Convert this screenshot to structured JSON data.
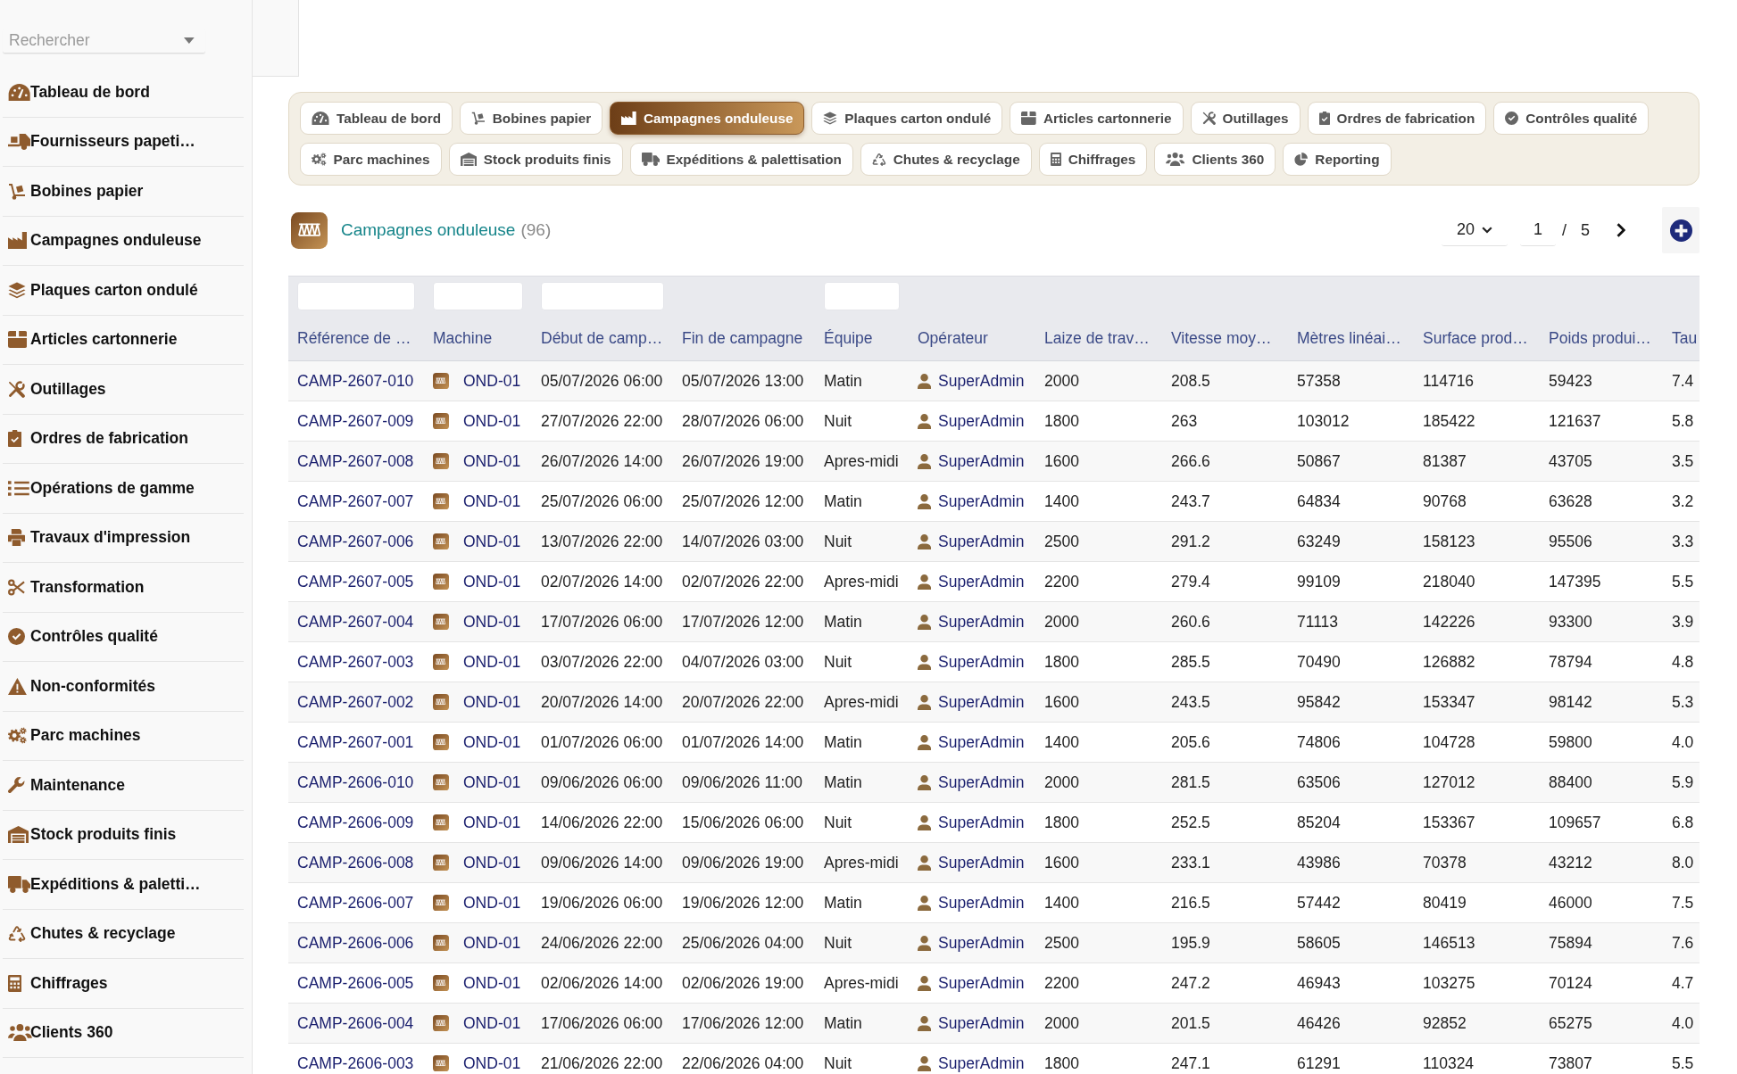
{
  "sidebar": {
    "search": {
      "placeholder": "Rechercher"
    },
    "items": [
      "Tableau de bord",
      "Fournisseurs papeti…",
      "Bobines papier",
      "Campagnes onduleuse",
      "Plaques carton ondulé",
      "Articles cartonnerie",
      "Outillages",
      "Ordres de fabrication",
      "Opérations de gamme",
      "Travaux d'impression",
      "Transformation",
      "Contrôles qualité",
      "Non-conformités",
      "Parc machines",
      "Maintenance",
      "Stock produits finis",
      "Expéditions & paletti…",
      "Chutes & recyclage",
      "Chiffrages",
      "Clients 360"
    ]
  },
  "tabs": [
    {
      "label": "Tableau de bord",
      "selected": false
    },
    {
      "label": "Bobines papier",
      "selected": false
    },
    {
      "label": "Campagnes onduleuse",
      "selected": true
    },
    {
      "label": "Plaques carton ondulé",
      "selected": false
    },
    {
      "label": "Articles cartonnerie",
      "selected": false
    },
    {
      "label": "Outillages",
      "selected": false
    },
    {
      "label": "Ordres de fabrication",
      "selected": false
    },
    {
      "label": "Contrôles qualité",
      "selected": false
    },
    {
      "label": "Parc machines",
      "selected": false
    },
    {
      "label": "Stock produits finis",
      "selected": false
    },
    {
      "label": "Expéditions & palettisation",
      "selected": false
    },
    {
      "label": "Chutes & recyclage",
      "selected": false
    },
    {
      "label": "Chiffrages",
      "selected": false
    },
    {
      "label": "Clients 360",
      "selected": false
    },
    {
      "label": "Reporting",
      "selected": false
    }
  ],
  "header": {
    "title": "Campagnes onduleuse",
    "count": "(96)"
  },
  "pagination": {
    "page_size": "20",
    "page": "1",
    "separator": "/",
    "total_pages": "5"
  },
  "table": {
    "columns": [
      {
        "label": "Référence de …",
        "kind": "link",
        "filter": true
      },
      {
        "label": "Machine",
        "kind": "machine",
        "filter": true
      },
      {
        "label": "Début de camp…",
        "kind": "text",
        "filter": true
      },
      {
        "label": "Fin de campagne",
        "kind": "text",
        "filter": false
      },
      {
        "label": "Équipe",
        "kind": "text",
        "filter": true
      },
      {
        "label": "Opérateur",
        "kind": "operator",
        "filter": false
      },
      {
        "label": "Laize de trav…",
        "kind": "text",
        "filter": false
      },
      {
        "label": "Vitesse moy…",
        "kind": "text",
        "filter": false
      },
      {
        "label": "Mètres linéai…",
        "kind": "text",
        "filter": false
      },
      {
        "label": "Surface prod…",
        "kind": "text",
        "filter": false
      },
      {
        "label": "Poids produi…",
        "kind": "text",
        "filter": false
      },
      {
        "label": "Tau",
        "kind": "text",
        "filter": false
      }
    ],
    "rows": [
      [
        "CAMP-2607-010",
        "OND-01",
        "05/07/2026 06:00",
        "05/07/2026 13:00",
        "Matin",
        "SuperAdmin",
        "2000",
        "208.5",
        "57358",
        "114716",
        "59423",
        "7.4"
      ],
      [
        "CAMP-2607-009",
        "OND-01",
        "27/07/2026 22:00",
        "28/07/2026 06:00",
        "Nuit",
        "SuperAdmin",
        "1800",
        "263",
        "103012",
        "185422",
        "121637",
        "5.8"
      ],
      [
        "CAMP-2607-008",
        "OND-01",
        "26/07/2026 14:00",
        "26/07/2026 19:00",
        "Apres-midi",
        "SuperAdmin",
        "1600",
        "266.6",
        "50867",
        "81387",
        "43705",
        "3.5"
      ],
      [
        "CAMP-2607-007",
        "OND-01",
        "25/07/2026 06:00",
        "25/07/2026 12:00",
        "Matin",
        "SuperAdmin",
        "1400",
        "243.7",
        "64834",
        "90768",
        "63628",
        "3.2"
      ],
      [
        "CAMP-2607-006",
        "OND-01",
        "13/07/2026 22:00",
        "14/07/2026 03:00",
        "Nuit",
        "SuperAdmin",
        "2500",
        "291.2",
        "63249",
        "158123",
        "95506",
        "3.3"
      ],
      [
        "CAMP-2607-005",
        "OND-01",
        "02/07/2026 14:00",
        "02/07/2026 22:00",
        "Apres-midi",
        "SuperAdmin",
        "2200",
        "279.4",
        "99109",
        "218040",
        "147395",
        "5.5"
      ],
      [
        "CAMP-2607-004",
        "OND-01",
        "17/07/2026 06:00",
        "17/07/2026 12:00",
        "Matin",
        "SuperAdmin",
        "2000",
        "260.6",
        "71113",
        "142226",
        "93300",
        "3.9"
      ],
      [
        "CAMP-2607-003",
        "OND-01",
        "03/07/2026 22:00",
        "04/07/2026 03:00",
        "Nuit",
        "SuperAdmin",
        "1800",
        "285.5",
        "70490",
        "126882",
        "78794",
        "4.8"
      ],
      [
        "CAMP-2607-002",
        "OND-01",
        "20/07/2026 14:00",
        "20/07/2026 22:00",
        "Apres-midi",
        "SuperAdmin",
        "1600",
        "243.5",
        "95842",
        "153347",
        "98142",
        "5.3"
      ],
      [
        "CAMP-2607-001",
        "OND-01",
        "01/07/2026 06:00",
        "01/07/2026 14:00",
        "Matin",
        "SuperAdmin",
        "1400",
        "205.6",
        "74806",
        "104728",
        "59800",
        "4.0"
      ],
      [
        "CAMP-2606-010",
        "OND-01",
        "09/06/2026 06:00",
        "09/06/2026 11:00",
        "Matin",
        "SuperAdmin",
        "2000",
        "281.5",
        "63506",
        "127012",
        "88400",
        "5.9"
      ],
      [
        "CAMP-2606-009",
        "OND-01",
        "14/06/2026 22:00",
        "15/06/2026 06:00",
        "Nuit",
        "SuperAdmin",
        "1800",
        "252.5",
        "85204",
        "153367",
        "109657",
        "6.8"
      ],
      [
        "CAMP-2606-008",
        "OND-01",
        "09/06/2026 14:00",
        "09/06/2026 19:00",
        "Apres-midi",
        "SuperAdmin",
        "1600",
        "233.1",
        "43986",
        "70378",
        "43212",
        "8.0"
      ],
      [
        "CAMP-2606-007",
        "OND-01",
        "19/06/2026 06:00",
        "19/06/2026 12:00",
        "Matin",
        "SuperAdmin",
        "1400",
        "216.5",
        "57442",
        "80419",
        "46000",
        "7.5"
      ],
      [
        "CAMP-2606-006",
        "OND-01",
        "24/06/2026 22:00",
        "25/06/2026 04:00",
        "Nuit",
        "SuperAdmin",
        "2500",
        "195.9",
        "58605",
        "146513",
        "75894",
        "7.6"
      ],
      [
        "CAMP-2606-005",
        "OND-01",
        "02/06/2026 14:00",
        "02/06/2026 19:00",
        "Apres-midi",
        "SuperAdmin",
        "2200",
        "247.2",
        "46943",
        "103275",
        "70124",
        "4.7"
      ],
      [
        "CAMP-2606-004",
        "OND-01",
        "17/06/2026 06:00",
        "17/06/2026 12:00",
        "Matin",
        "SuperAdmin",
        "2000",
        "201.5",
        "46426",
        "92852",
        "65275",
        "4.0"
      ],
      [
        "CAMP-2606-003",
        "OND-01",
        "21/06/2026 22:00",
        "22/06/2026 04:00",
        "Nuit",
        "SuperAdmin",
        "1800",
        "247.1",
        "61291",
        "110324",
        "73807",
        "5.5"
      ]
    ]
  }
}
